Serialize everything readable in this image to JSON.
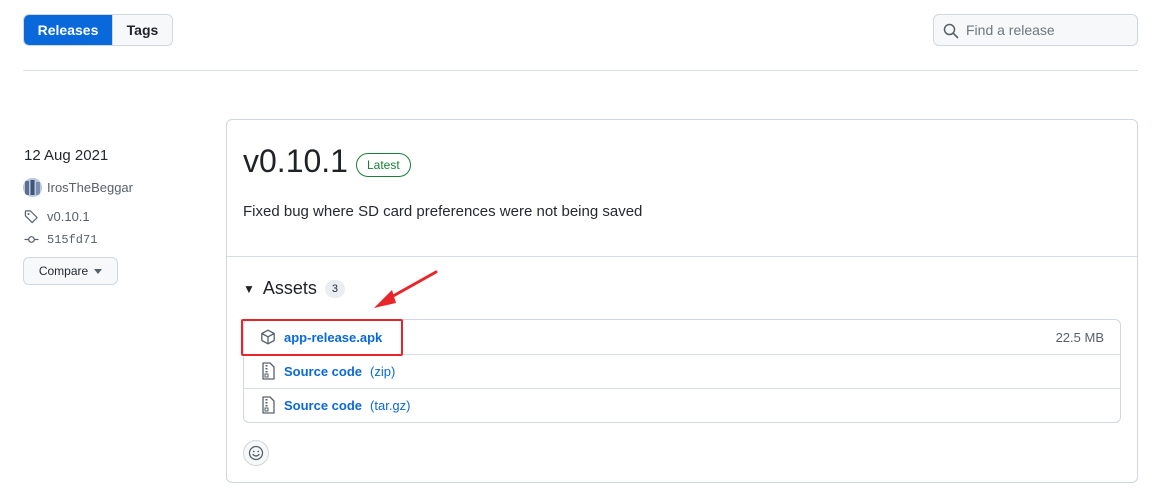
{
  "tabs": [
    {
      "label": "Releases",
      "active": true
    },
    {
      "label": "Tags",
      "active": false
    }
  ],
  "search": {
    "placeholder": "Find a release",
    "icon": "search-icon"
  },
  "sidebar": {
    "date": "12 Aug 2021",
    "author": "IrosTheBeggar",
    "tag": "v0.10.1",
    "commit": "515fd71",
    "compare_label": "Compare"
  },
  "release": {
    "version": "v0.10.1",
    "badge": "Latest",
    "description": "Fixed bug where SD card preferences were not being saved",
    "assets_title": "Assets",
    "assets_count": "3",
    "assets": [
      {
        "name": "app-release.apk",
        "ext": "",
        "size": "22.5 MB",
        "icon": "package-icon"
      },
      {
        "name": "Source code",
        "ext": "(zip)",
        "size": "",
        "icon": "file-zip-icon"
      },
      {
        "name": "Source code",
        "ext": "(tar.gz)",
        "size": "",
        "icon": "file-zip-icon"
      }
    ]
  },
  "colors": {
    "accent": "#0969da",
    "latest_badge": "#1a7f37",
    "annotation": "#e8262a"
  }
}
